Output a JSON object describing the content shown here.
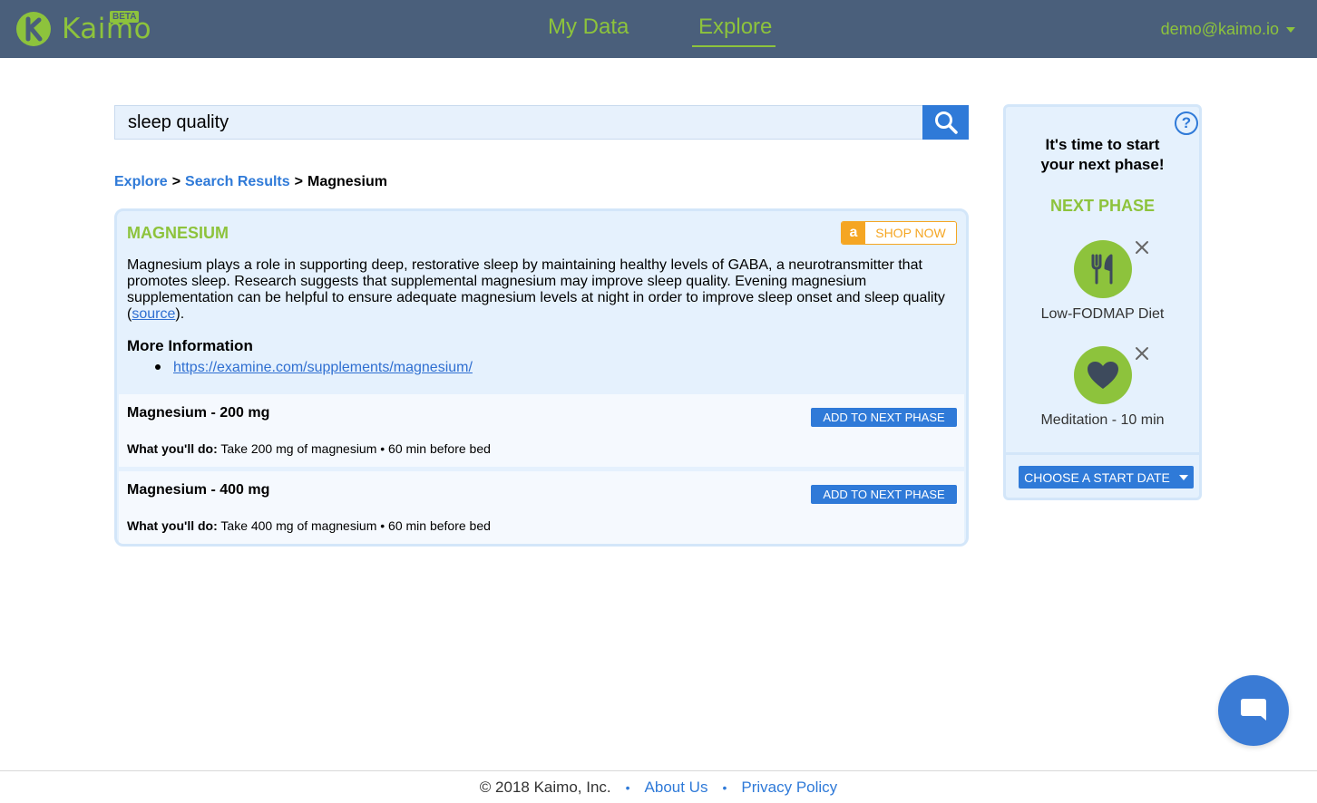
{
  "header": {
    "brand": "Kaimo",
    "beta_badge": "BETA",
    "nav": [
      {
        "label": "My Data"
      },
      {
        "label": "Explore"
      }
    ],
    "user_email": "demo@kaimo.io"
  },
  "search": {
    "query": "sleep quality",
    "icon": "search-icon"
  },
  "breadcrumb": {
    "items": [
      "Explore",
      "Search Results",
      "Magnesium"
    ],
    "separator": ">"
  },
  "supplement": {
    "title": "MAGNESIUM",
    "shop_icon": "a",
    "shop_label": "SHOP NOW",
    "description_before_link": "Magnesium plays a role in supporting deep, restorative sleep by maintaining healthy levels of GABA, a neurotransmitter that promotes sleep. Research suggests that supplemental magnesium may improve sleep quality. Evening magnesium supplementation can be helpful to ensure adequate magnesium levels at night in order to improve sleep onset and sleep quality (",
    "source_link": "source",
    "description_after_link": ").",
    "more_info_heading": "More Information",
    "more_info_links": [
      "https://examine.com/supplements/magnesium/"
    ],
    "doses": [
      {
        "title": "Magnesium - 200 mg",
        "detail_label": "What you'll do:",
        "detail_text": " Take 200 mg of magnesium • 60 min before bed",
        "button": "ADD TO NEXT PHASE"
      },
      {
        "title": "Magnesium - 400 mg",
        "detail_label": "What you'll do:",
        "detail_text": " Take 400 mg of magnesium • 60 min before bed",
        "button": "ADD TO NEXT PHASE"
      }
    ]
  },
  "side_panel": {
    "help_icon": "?",
    "heading_line1": "It's time to start",
    "heading_line2": "your next phase!",
    "next_phase_label": "NEXT PHASE",
    "items": [
      {
        "label": "Low-FODMAP Diet",
        "icon": "fork-knife-icon"
      },
      {
        "label": "Meditation - 10 min",
        "icon": "heart-icon"
      }
    ],
    "date_button": "CHOOSE A START DATE"
  },
  "footer": {
    "copyright": "© 2018 Kaimo, Inc.",
    "separator": "•",
    "links": [
      "About Us",
      "Privacy Policy"
    ]
  },
  "colors": {
    "header_bg": "#4a5f7b",
    "brand_green": "#8dc33c",
    "accent_blue": "#2f7ad8",
    "card_bg": "#e5f1fd",
    "amazon_orange": "#f5a623"
  }
}
